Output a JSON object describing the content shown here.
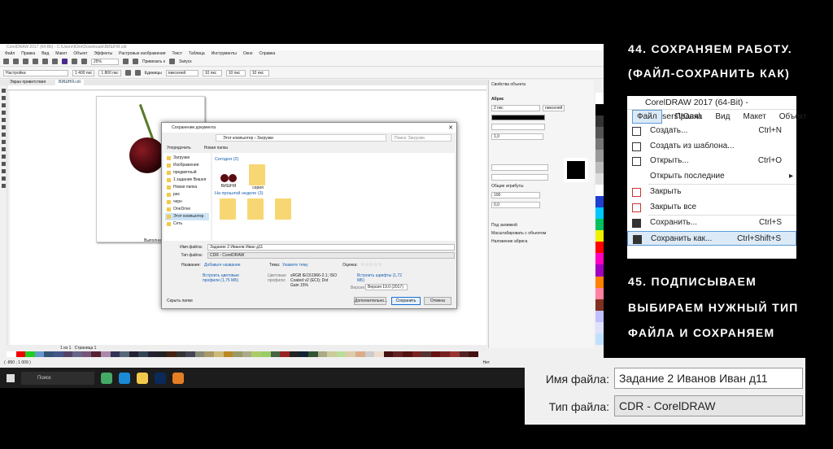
{
  "app": {
    "title": "CorelDRAW 2017 (64-Bit) - C:\\Users\\Юля\\Downloads\\ВИШНЯ.cdr",
    "menu": [
      "Файл",
      "Правка",
      "Вид",
      "Макет",
      "Объект",
      "Эффекты",
      "Растровые изображения",
      "Текст",
      "Таблица",
      "Инструменты",
      "Окно",
      "Справка"
    ],
    "zoom": "25%",
    "snap": "Привязать к",
    "launch": "Запуск",
    "preset": "Настройка",
    "width": "1 400 пкс",
    "height": "1 800 пкс",
    "units_label": "Единицы",
    "units": "пикселей",
    "nudge": "10 пкс",
    "dup_x": "10 пкс",
    "dup_y": "10 пкс",
    "tabs": [
      "Экран приветствия",
      "ВИШНЯ.cdr"
    ],
    "page_caption": "Выполнил",
    "page_tab": "Страница 1",
    "page_nav": "1 из 1",
    "coords": "( -850 ; 1 009 )",
    "fill_none": "Нет"
  },
  "docker": {
    "title": "Свойства объекта",
    "section": "Абрис",
    "stroke_width": "2 пкс",
    "stroke_units": "пикселей",
    "miter": "1,0",
    "shared": "Общие атрибуты",
    "stretch": "100",
    "angle": "0,0",
    "opts": [
      "Под заливкой",
      "Масштабировать с объектом",
      "Наложение абриса"
    ],
    "outline_color": "#000000"
  },
  "dialog": {
    "title": "Сохранение документа",
    "path": [
      "Этот компьютер",
      "Загрузки"
    ],
    "search_placeholder": "Поиск: Загрузки",
    "organize": "Упорядочить",
    "new_folder": "Новая папка",
    "nav": [
      "Загрузки",
      "Изображения",
      "предметный",
      "1 задание Вишня",
      "Новая папка",
      "рис",
      "черн",
      "OneDrive",
      "Этот компьютер",
      "Сеть"
    ],
    "groups": [
      {
        "label": "Сегодня (2)",
        "items": [
          "ВИШНЯ",
          "серия"
        ]
      },
      {
        "label": "На прошлой неделе (3)"
      }
    ],
    "filename_label": "Имя файла:",
    "filename": "Задание 2 Иванов Иван д11",
    "type_label": "Тип файла:",
    "type": "CDR - CorelDRAW",
    "title_label": "Название:",
    "title_link": "Добавьте название",
    "theme_label": "Тема:",
    "theme_link": "Укажите тему",
    "rating_label": "Оценка:",
    "rating": "☆☆☆☆☆",
    "embed_profiles": "Встроить цветовые профили (1,75 MБ)",
    "profiles_label": "Цветовые профили:",
    "profiles": "sRGB IEC61966-2.1; ISO Coated v2 (ECI); Dot Gain 15%",
    "embed_fonts": "Встроить шрифты (1,72 MБ)",
    "version_label": "Версия:",
    "version": "Версия 19.0 (2017)",
    "hide": "Скрыть папки",
    "advanced": "Дополнительно...",
    "save": "Сохранить",
    "cancel": "Отмена"
  },
  "taskbar": {
    "search": "Поиск"
  },
  "right": {
    "step44_1": "44. СОХРАНЯЕМ РАБОТУ.",
    "step44_2": "(ФАЙЛ-СОХРАНИТЬ КАК)",
    "step45_1": "45. ПОДПИСЫВАЕМ",
    "step45_2": "ВЫБИРАЕМ НУЖНЫЙ ТИП",
    "step45_3": "ФАЙЛА И СОХРАНЯЕМ"
  },
  "menu_inset": {
    "title": "CorelDRAW 2017 (64-Bit) - C:\\Users\\Юля\\",
    "bar": [
      "Файл",
      "Правка",
      "Вид",
      "Макет",
      "Объект"
    ],
    "items": [
      {
        "label": "Создать...",
        "key": "Ctrl+N"
      },
      {
        "label": "Создать из шаблона...",
        "key": ""
      },
      {
        "label": "Открыть...",
        "key": "Ctrl+O"
      },
      {
        "label": "Открыть последние",
        "key": "▸"
      },
      {
        "label": "Закрыть",
        "key": ""
      },
      {
        "label": "Закрыть все",
        "key": ""
      },
      {
        "label": "Сохранить...",
        "key": "Ctrl+S"
      },
      {
        "label": "Сохранить как...",
        "key": "Ctrl+Shift+S"
      }
    ]
  },
  "file_inset": {
    "name_label": "Имя файла:",
    "name": "Задание 2 Иванов Иван д11",
    "type_label": "Тип файла:",
    "type": "CDR - CorelDRAW"
  }
}
